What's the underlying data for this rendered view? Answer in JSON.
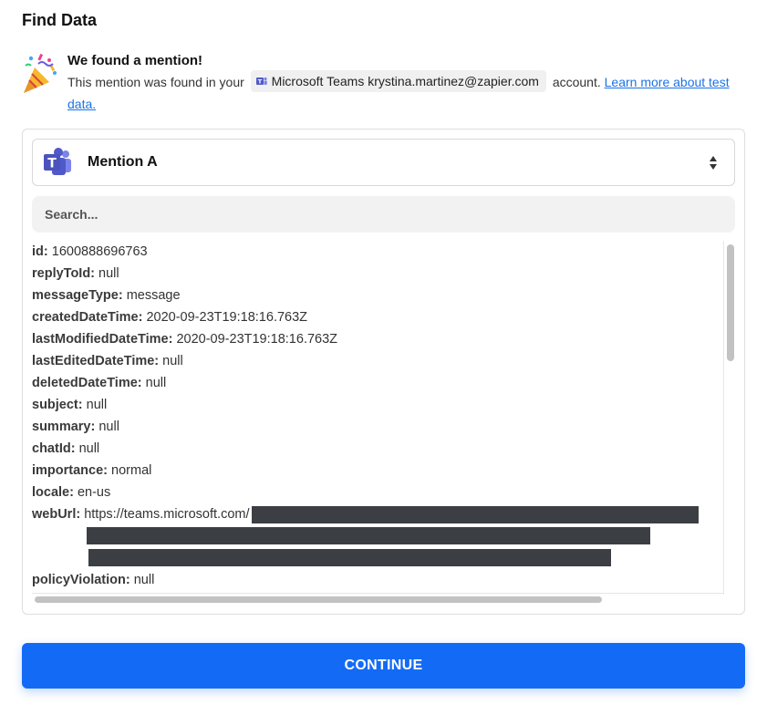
{
  "page": {
    "title": "Find Data"
  },
  "found": {
    "heading": "We found a mention!",
    "text_before": "This mention was found in your",
    "account_label": "Microsoft Teams krystina.martinez@zapier.com",
    "text_after": "account.",
    "link_label": "Learn more about test data."
  },
  "select": {
    "value": "Mention A",
    "icon": "microsoft-teams-icon"
  },
  "search": {
    "placeholder": "Search..."
  },
  "fields": [
    {
      "key": "id:",
      "value": "1600888696763"
    },
    {
      "key": "replyToId:",
      "value": "null"
    },
    {
      "key": "messageType:",
      "value": "message"
    },
    {
      "key": "createdDateTime:",
      "value": "2020-09-23T19:18:16.763Z"
    },
    {
      "key": "lastModifiedDateTime:",
      "value": "2020-09-23T19:18:16.763Z"
    },
    {
      "key": "lastEditedDateTime:",
      "value": "null"
    },
    {
      "key": "deletedDateTime:",
      "value": "null"
    },
    {
      "key": "subject:",
      "value": "null"
    },
    {
      "key": "summary:",
      "value": "null"
    },
    {
      "key": "chatId:",
      "value": "null"
    },
    {
      "key": "importance:",
      "value": "normal"
    },
    {
      "key": "locale:",
      "value": "en-us"
    },
    {
      "key": "webUrl:",
      "value": "https://teams.microsoft.com/"
    },
    {
      "key": "policyViolation:",
      "value": "null"
    }
  ],
  "actions": {
    "continue_label": "CONTINUE"
  },
  "colors": {
    "primary": "#136bf5",
    "teams_purple": "#5059c9",
    "redaction": "#3b3e42"
  }
}
